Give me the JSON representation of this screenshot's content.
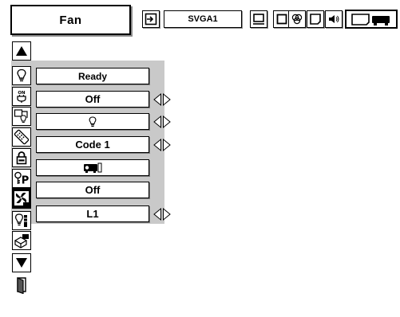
{
  "header": {
    "title": "Fan",
    "input_source": "SVGA1",
    "toolbar_icons": [
      "input-icon",
      "pc-adjust-icon",
      "image-icon",
      "color-icon",
      "screen-icon",
      "sound-icon",
      "setting-icon"
    ]
  },
  "sidebar": {
    "icons": [
      "up-arrow-icon",
      "lamp-icon",
      "power-on-icon",
      "lamp-mode-icon",
      "remote-code-icon",
      "key-lock-icon",
      "pin-code-lock-icon",
      "fan-icon",
      "lamp-counter-icon",
      "factory-default-icon",
      "down-arrow-icon",
      "exit-icon"
    ]
  },
  "menu": {
    "rows": [
      {
        "label": "Ready",
        "has_arrows": false
      },
      {
        "label": "Off",
        "has_arrows": true
      },
      {
        "label": "",
        "icon": "lamp-icon",
        "has_arrows": true
      },
      {
        "label": "Code 1",
        "has_arrows": true
      },
      {
        "label": "",
        "icon": "projector-icon",
        "has_arrows": false
      },
      {
        "label": "Off",
        "has_arrows": false
      },
      {
        "label": "L1",
        "has_arrows": true
      }
    ]
  },
  "colors": {
    "panel_grey": "#c9c9c9",
    "selected": "#000000"
  }
}
